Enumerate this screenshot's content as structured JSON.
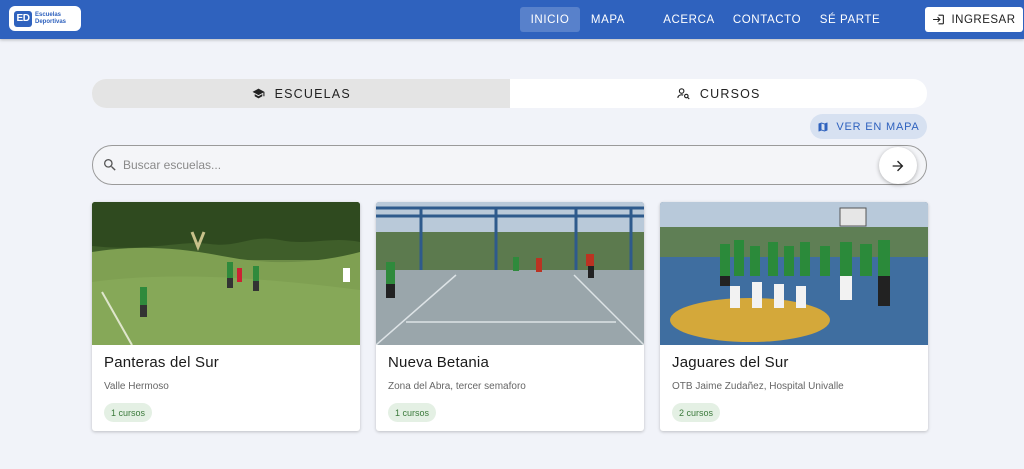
{
  "nav": {
    "logo_mark": "ED",
    "logo_line1": "Escuelas",
    "logo_line2": "Deportivas",
    "links": [
      "INICIO",
      "MAPA",
      "ACERCA",
      "CONTACTO",
      "SÉ PARTE"
    ],
    "active_link": "INICIO",
    "login_label": "INGRESAR"
  },
  "tabs": [
    {
      "label": "ESCUELAS",
      "icon": "graduation-cap-icon",
      "active": true
    },
    {
      "label": "CURSOS",
      "icon": "person-search-icon",
      "active": false
    }
  ],
  "map_button": {
    "label": "VER EN MAPA",
    "icon": "map-icon"
  },
  "search": {
    "placeholder": "Buscar escuelas...",
    "value": ""
  },
  "schools": [
    {
      "name": "Panteras del Sur",
      "location": "Valle Hermoso",
      "courses": "1 cursos",
      "image": "soccer-field-photo"
    },
    {
      "name": "Nueva Betania",
      "location": "Zona del Abra, tercer semaforo",
      "courses": "1 cursos",
      "image": "futsal-court-photo"
    },
    {
      "name": "Jaguares del Sur",
      "location": "OTB Jaime Zudañez, Hospital Univalle",
      "courses": "2 cursos",
      "image": "team-photo"
    }
  ],
  "colors": {
    "primary": "#2f62be",
    "chip_bg": "#e4f0e4",
    "chip_text": "#3b7a3b"
  }
}
